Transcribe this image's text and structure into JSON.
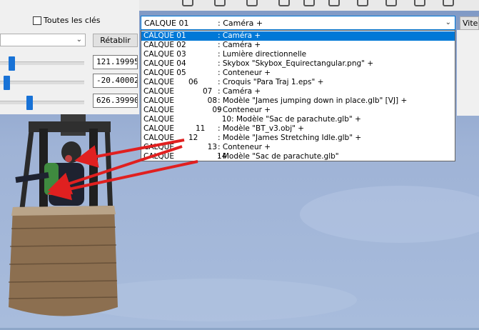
{
  "toolbar": {
    "all_keys_label": "Toutes les clés",
    "reset_label": "Rétablir",
    "speed_label": "Vites"
  },
  "values": {
    "v1": "121.19995",
    "v2": "-20.40002",
    "v3": "626.39990"
  },
  "layer_combo": {
    "selected_layer": "CALQUE 01",
    "selected_content": ": Caméra +"
  },
  "layers": [
    {
      "a": "CALQUE 01",
      "b": ": Caméra +"
    },
    {
      "a": "CALQUE 02",
      "b": ": Caméra +"
    },
    {
      "a": "CALQUE 03",
      "b": ": Lumière directionnelle"
    },
    {
      "a": "CALQUE 04",
      "b": ": Skybox \"Skybox_Equirectangular.png\" +"
    },
    {
      "a": "CALQUE 05",
      "b": ": Conteneur +"
    },
    {
      "a": "CALQUE      06",
      "b": ": Croquis \"Para Traj 1.eps\" +"
    },
    {
      "a": "CALQUE            07",
      "b": ": Caméra +"
    },
    {
      "a": "CALQUE              08",
      "b": ": Modèle \"James jumping down in place.glb\" [VJ] +"
    },
    {
      "a": "CALQUE                09",
      "b": ": Conteneur +"
    },
    {
      "a": "CALQUE                    10: Modèle \"Sac de parachute.glb\" +",
      "b": ""
    },
    {
      "a": "CALQUE         11",
      "b": ": Modèle \"BT_v3.obj\" +"
    },
    {
      "a": "CALQUE      12",
      "b": ": Modèle \"James Stretching Idle.glb\" +"
    },
    {
      "a": "CALQUE              13",
      "b": ": Conteneur +"
    },
    {
      "a": "CALQUE                  14",
      "b": ": Modèle \"Sac de parachute.glb\""
    }
  ],
  "colors": {
    "selection": "#0078d7",
    "arrow": "#e02020"
  }
}
